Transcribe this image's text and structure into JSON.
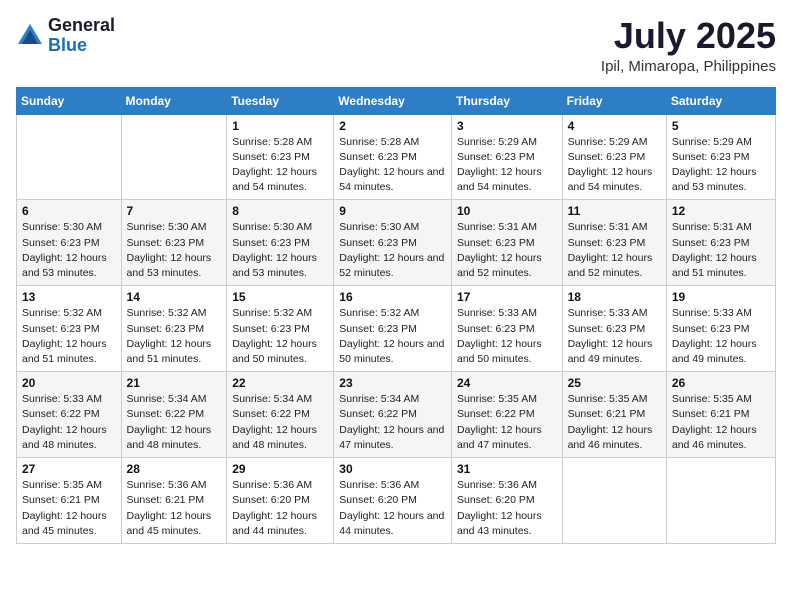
{
  "logo": {
    "general": "General",
    "blue": "Blue"
  },
  "header": {
    "month": "July 2025",
    "location": "Ipil, Mimaropa, Philippines"
  },
  "weekdays": [
    "Sunday",
    "Monday",
    "Tuesday",
    "Wednesday",
    "Thursday",
    "Friday",
    "Saturday"
  ],
  "weeks": [
    [
      {
        "day": "",
        "sunrise": "",
        "sunset": "",
        "daylight": ""
      },
      {
        "day": "",
        "sunrise": "",
        "sunset": "",
        "daylight": ""
      },
      {
        "day": "1",
        "sunrise": "Sunrise: 5:28 AM",
        "sunset": "Sunset: 6:23 PM",
        "daylight": "Daylight: 12 hours and 54 minutes."
      },
      {
        "day": "2",
        "sunrise": "Sunrise: 5:28 AM",
        "sunset": "Sunset: 6:23 PM",
        "daylight": "Daylight: 12 hours and 54 minutes."
      },
      {
        "day": "3",
        "sunrise": "Sunrise: 5:29 AM",
        "sunset": "Sunset: 6:23 PM",
        "daylight": "Daylight: 12 hours and 54 minutes."
      },
      {
        "day": "4",
        "sunrise": "Sunrise: 5:29 AM",
        "sunset": "Sunset: 6:23 PM",
        "daylight": "Daylight: 12 hours and 54 minutes."
      },
      {
        "day": "5",
        "sunrise": "Sunrise: 5:29 AM",
        "sunset": "Sunset: 6:23 PM",
        "daylight": "Daylight: 12 hours and 53 minutes."
      }
    ],
    [
      {
        "day": "6",
        "sunrise": "Sunrise: 5:30 AM",
        "sunset": "Sunset: 6:23 PM",
        "daylight": "Daylight: 12 hours and 53 minutes."
      },
      {
        "day": "7",
        "sunrise": "Sunrise: 5:30 AM",
        "sunset": "Sunset: 6:23 PM",
        "daylight": "Daylight: 12 hours and 53 minutes."
      },
      {
        "day": "8",
        "sunrise": "Sunrise: 5:30 AM",
        "sunset": "Sunset: 6:23 PM",
        "daylight": "Daylight: 12 hours and 53 minutes."
      },
      {
        "day": "9",
        "sunrise": "Sunrise: 5:30 AM",
        "sunset": "Sunset: 6:23 PM",
        "daylight": "Daylight: 12 hours and 52 minutes."
      },
      {
        "day": "10",
        "sunrise": "Sunrise: 5:31 AM",
        "sunset": "Sunset: 6:23 PM",
        "daylight": "Daylight: 12 hours and 52 minutes."
      },
      {
        "day": "11",
        "sunrise": "Sunrise: 5:31 AM",
        "sunset": "Sunset: 6:23 PM",
        "daylight": "Daylight: 12 hours and 52 minutes."
      },
      {
        "day": "12",
        "sunrise": "Sunrise: 5:31 AM",
        "sunset": "Sunset: 6:23 PM",
        "daylight": "Daylight: 12 hours and 51 minutes."
      }
    ],
    [
      {
        "day": "13",
        "sunrise": "Sunrise: 5:32 AM",
        "sunset": "Sunset: 6:23 PM",
        "daylight": "Daylight: 12 hours and 51 minutes."
      },
      {
        "day": "14",
        "sunrise": "Sunrise: 5:32 AM",
        "sunset": "Sunset: 6:23 PM",
        "daylight": "Daylight: 12 hours and 51 minutes."
      },
      {
        "day": "15",
        "sunrise": "Sunrise: 5:32 AM",
        "sunset": "Sunset: 6:23 PM",
        "daylight": "Daylight: 12 hours and 50 minutes."
      },
      {
        "day": "16",
        "sunrise": "Sunrise: 5:32 AM",
        "sunset": "Sunset: 6:23 PM",
        "daylight": "Daylight: 12 hours and 50 minutes."
      },
      {
        "day": "17",
        "sunrise": "Sunrise: 5:33 AM",
        "sunset": "Sunset: 6:23 PM",
        "daylight": "Daylight: 12 hours and 50 minutes."
      },
      {
        "day": "18",
        "sunrise": "Sunrise: 5:33 AM",
        "sunset": "Sunset: 6:23 PM",
        "daylight": "Daylight: 12 hours and 49 minutes."
      },
      {
        "day": "19",
        "sunrise": "Sunrise: 5:33 AM",
        "sunset": "Sunset: 6:23 PM",
        "daylight": "Daylight: 12 hours and 49 minutes."
      }
    ],
    [
      {
        "day": "20",
        "sunrise": "Sunrise: 5:33 AM",
        "sunset": "Sunset: 6:22 PM",
        "daylight": "Daylight: 12 hours and 48 minutes."
      },
      {
        "day": "21",
        "sunrise": "Sunrise: 5:34 AM",
        "sunset": "Sunset: 6:22 PM",
        "daylight": "Daylight: 12 hours and 48 minutes."
      },
      {
        "day": "22",
        "sunrise": "Sunrise: 5:34 AM",
        "sunset": "Sunset: 6:22 PM",
        "daylight": "Daylight: 12 hours and 48 minutes."
      },
      {
        "day": "23",
        "sunrise": "Sunrise: 5:34 AM",
        "sunset": "Sunset: 6:22 PM",
        "daylight": "Daylight: 12 hours and 47 minutes."
      },
      {
        "day": "24",
        "sunrise": "Sunrise: 5:35 AM",
        "sunset": "Sunset: 6:22 PM",
        "daylight": "Daylight: 12 hours and 47 minutes."
      },
      {
        "day": "25",
        "sunrise": "Sunrise: 5:35 AM",
        "sunset": "Sunset: 6:21 PM",
        "daylight": "Daylight: 12 hours and 46 minutes."
      },
      {
        "day": "26",
        "sunrise": "Sunrise: 5:35 AM",
        "sunset": "Sunset: 6:21 PM",
        "daylight": "Daylight: 12 hours and 46 minutes."
      }
    ],
    [
      {
        "day": "27",
        "sunrise": "Sunrise: 5:35 AM",
        "sunset": "Sunset: 6:21 PM",
        "daylight": "Daylight: 12 hours and 45 minutes."
      },
      {
        "day": "28",
        "sunrise": "Sunrise: 5:36 AM",
        "sunset": "Sunset: 6:21 PM",
        "daylight": "Daylight: 12 hours and 45 minutes."
      },
      {
        "day": "29",
        "sunrise": "Sunrise: 5:36 AM",
        "sunset": "Sunset: 6:20 PM",
        "daylight": "Daylight: 12 hours and 44 minutes."
      },
      {
        "day": "30",
        "sunrise": "Sunrise: 5:36 AM",
        "sunset": "Sunset: 6:20 PM",
        "daylight": "Daylight: 12 hours and 44 minutes."
      },
      {
        "day": "31",
        "sunrise": "Sunrise: 5:36 AM",
        "sunset": "Sunset: 6:20 PM",
        "daylight": "Daylight: 12 hours and 43 minutes."
      },
      {
        "day": "",
        "sunrise": "",
        "sunset": "",
        "daylight": ""
      },
      {
        "day": "",
        "sunrise": "",
        "sunset": "",
        "daylight": ""
      }
    ]
  ]
}
